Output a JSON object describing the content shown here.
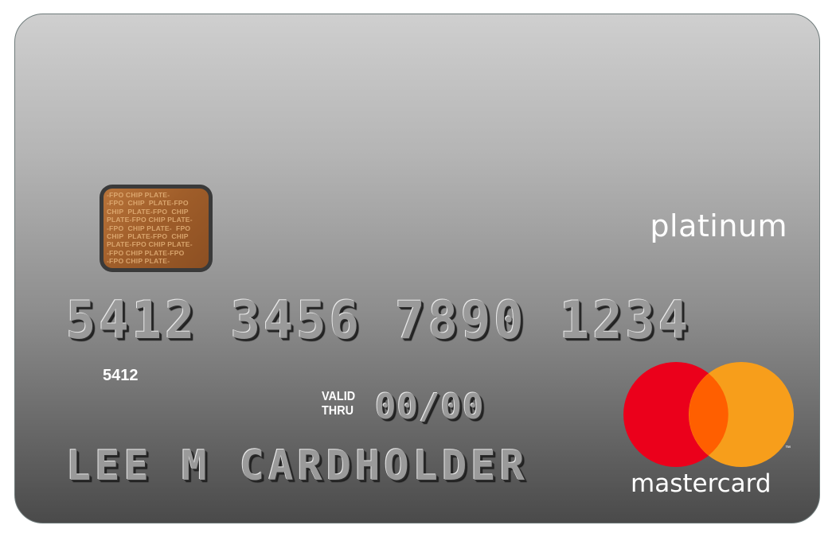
{
  "card": {
    "tier": "platinum",
    "chip_text": "-FPO CHIP PLATE-\n-FPO  CHIP  PLATE-FPO\nCHIP  PLATE-FPO  CHIP\nPLATE-FPO CHIP PLATE-\n-FPO  CHIP PLATE-  FPO\nCHIP  PLATE-FPO  CHIP\nPLATE-FPO CHIP PLATE-\n-FPO CHIP PLATE-FPO\n-FPO CHIP PLATE-",
    "number": "5412 3456 7890 1234",
    "bin_small": "5412",
    "valid_thru_label_line1": "VALID",
    "valid_thru_label_line2": "THRU",
    "expiry": "00/00",
    "cardholder": "LEE M CARDHOLDER",
    "network_wordmark": "mastercard",
    "trademark": "™"
  },
  "colors": {
    "mc_red": "#eb001b",
    "mc_orange": "#f79e1b",
    "mc_overlap": "#ff5f00",
    "chip_copper": "#a05e2a"
  },
  "icons": {
    "chip": "emv-chip-icon",
    "network_logo": "mastercard-logo-icon"
  }
}
